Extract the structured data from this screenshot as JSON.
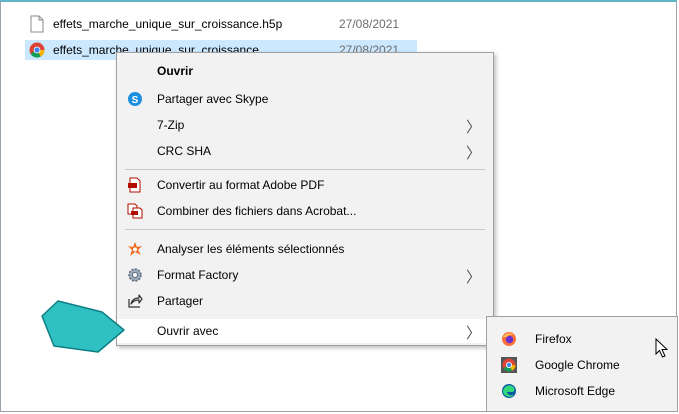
{
  "files": [
    {
      "name": "effets_marche_unique_sur_croissance.h5p",
      "date": "27/08/2021",
      "icon": "blank-file-icon",
      "selected": false
    },
    {
      "name": "effets_marche_unique_sur_croissance",
      "date": "27/08/2021",
      "icon": "chrome-icon",
      "selected": true
    }
  ],
  "context_menu": {
    "open": "Ouvrir",
    "skype": "Partager avec Skype",
    "zip": "7-Zip",
    "crc": "CRC SHA",
    "convert_pdf": "Convertir au format Adobe PDF",
    "combine_acrobat": "Combiner des fichiers dans Acrobat...",
    "analyze": "Analyser les éléments sélectionnés",
    "format_factory": "Format Factory",
    "share": "Partager",
    "open_with": "Ouvrir avec"
  },
  "open_with_menu": {
    "firefox": "Firefox",
    "chrome": "Google Chrome",
    "edge": "Microsoft Edge"
  },
  "submenu_arrow": "〉",
  "colors": {
    "selection": "#cce8ff",
    "callout": "#2fc1c1",
    "skype": "#1e8fe0",
    "avast": "#f26b1d"
  }
}
